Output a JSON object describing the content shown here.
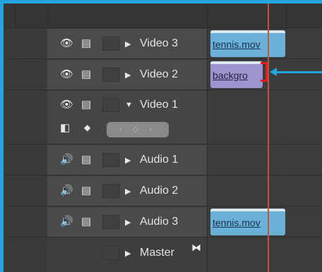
{
  "tracks": {
    "video3": {
      "label": "Video 3",
      "clip": "tennis.mov"
    },
    "video2": {
      "label": "Video 2",
      "clip": "backgro"
    },
    "video1": {
      "label": "Video 1"
    },
    "audio1": {
      "label": "Audio 1"
    },
    "audio2": {
      "label": "Audio 2"
    },
    "audio3": {
      "label": "Audio 3",
      "clip": "tennis.mov"
    },
    "master": {
      "label": "Master"
    }
  },
  "icons": {
    "eye": "eye-icon",
    "film": "film-strip-icon",
    "speaker": "speaker-icon",
    "expand": "triangle-right-icon",
    "collapse": "triangle-down-icon",
    "master": "bowtie-icon"
  },
  "colors": {
    "callout": "#23a6de",
    "playhead": "#b9573a",
    "edit_marker": "#e21b24",
    "clip_video": "#6bb0d8",
    "clip_video2": "#9c93cf"
  }
}
